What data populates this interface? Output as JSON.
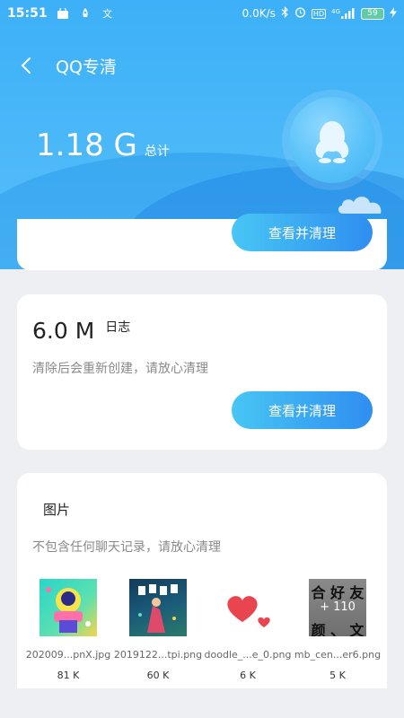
{
  "status_bar": {
    "time": "15:51",
    "network_speed": "0.0K/s",
    "signal_label": "4G",
    "hd_label": "HD",
    "battery": "59"
  },
  "header": {
    "title": "QQ专清",
    "total_value": "1.18 G",
    "total_label": "总计"
  },
  "card_top": {
    "button_label": "查看并清理"
  },
  "log_card": {
    "size": "6.0 M",
    "label": "日志",
    "description": "清除后会重新创建，请放心清理",
    "button_label": "查看并清理"
  },
  "image_card": {
    "title": "图片",
    "description": "不包含任何聊天记录，请放心清理",
    "thumbnails": [
      {
        "name": "202009...pnX.jpg",
        "size": "81 K"
      },
      {
        "name": "2019122...tpi.png",
        "size": "60 K"
      },
      {
        "name": "doodle_...e_0.png",
        "size": "6 K"
      },
      {
        "name": "mb_cen...er6.png",
        "size": "5 K",
        "overlay_text": "+ 110",
        "glyphs_top": [
          "合",
          "好",
          "友"
        ],
        "glyphs_bottom": [
          "颜",
          "、",
          "文"
        ]
      }
    ]
  },
  "colors": {
    "header_blue": "#3db0f7",
    "button_gradient_start": "#48c6f4",
    "button_gradient_end": "#2f8ef0"
  }
}
